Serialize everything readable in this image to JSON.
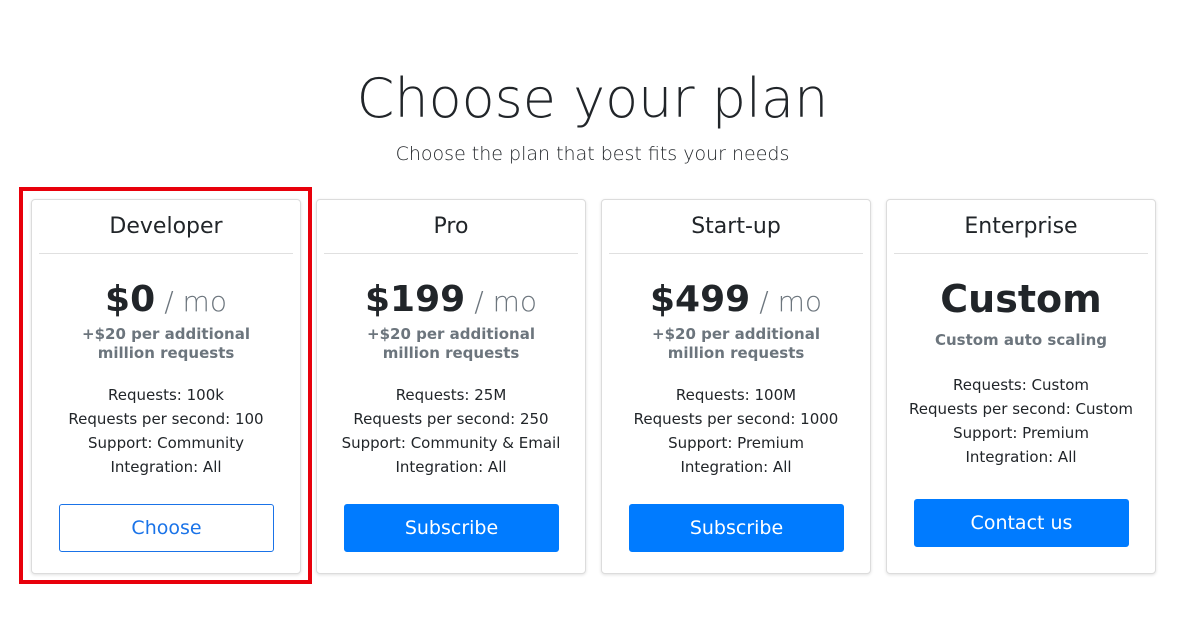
{
  "header": {
    "title": "Choose your plan",
    "subtitle": "Choose the plan that best fits your needs"
  },
  "plans": [
    {
      "name": "Developer",
      "price": "$0",
      "period": "/ mo",
      "note": "+$20 per additional million requests",
      "features": [
        "Requests: 100k",
        "Requests per second: 100",
        "Support: Community",
        "Integration: All"
      ],
      "button": "Choose",
      "highlighted": true
    },
    {
      "name": "Pro",
      "price": "$199",
      "period": "/ mo",
      "note": "+$20 per additional million requests",
      "features": [
        "Requests: 25M",
        "Requests per second: 250",
        "Support: Community & Email",
        "Integration: All"
      ],
      "button": "Subscribe"
    },
    {
      "name": "Start-up",
      "price": "$499",
      "period": "/ mo",
      "note": "+$20 per additional million requests",
      "features": [
        "Requests: 100M",
        "Requests per second: 1000",
        "Support: Premium",
        "Integration: All"
      ],
      "button": "Subscribe"
    },
    {
      "name": "Enterprise",
      "price": "Custom",
      "note": "Custom auto scaling",
      "features": [
        "Requests: Custom",
        "Requests per second: Custom",
        "Support: Premium",
        "Integration: All"
      ],
      "button": "Contact us"
    }
  ],
  "colors": {
    "primary": "#007bff",
    "highlight_border": "#e8000b",
    "muted_text": "#6c757d"
  }
}
